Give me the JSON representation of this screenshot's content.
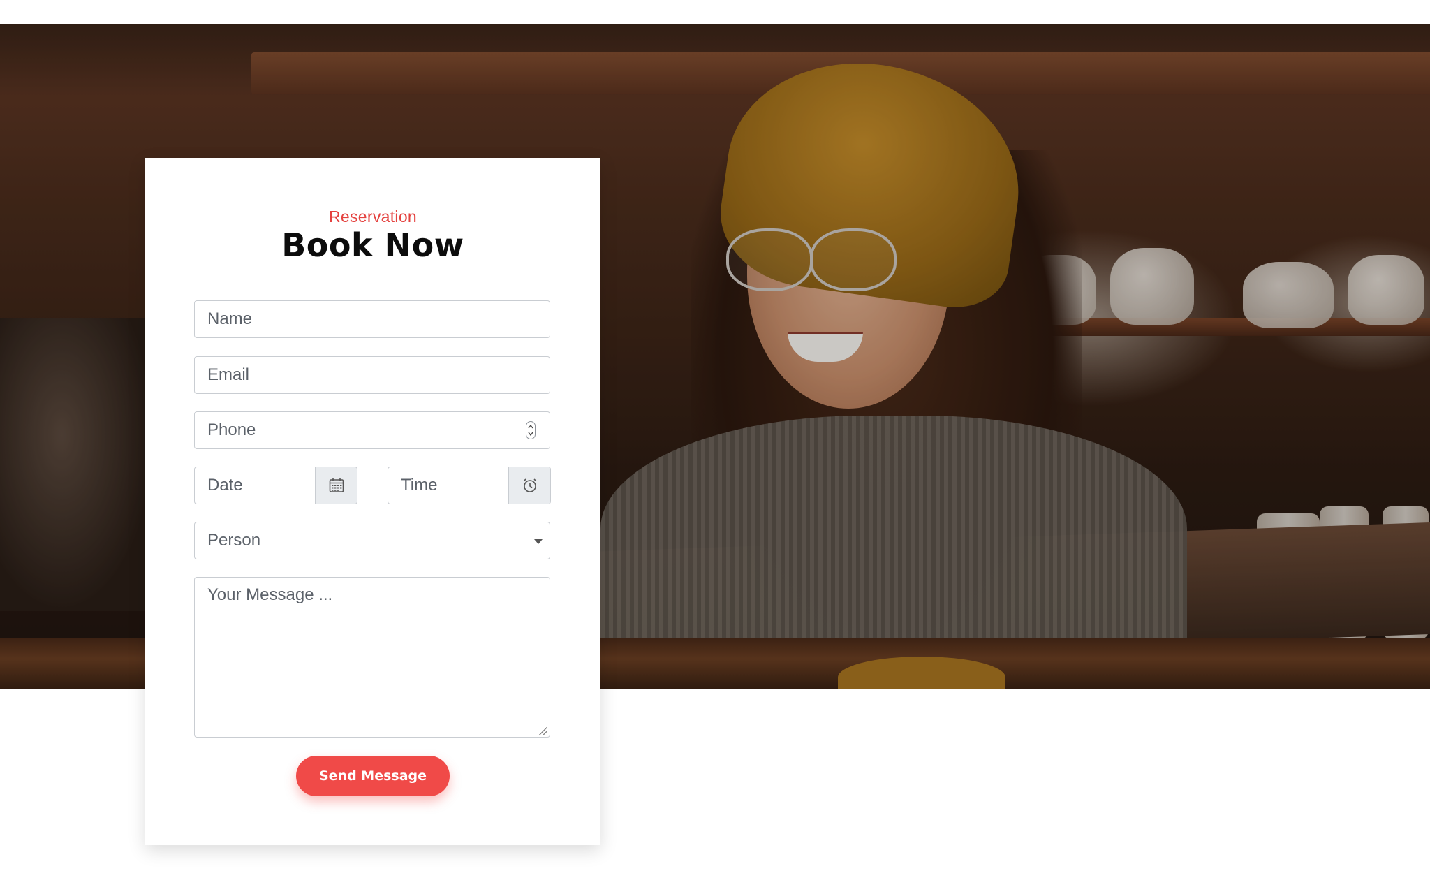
{
  "reservation": {
    "eyebrow": "Reservation",
    "title": "Book Now"
  },
  "form": {
    "name_placeholder": "Name",
    "email_placeholder": "Email",
    "phone_placeholder": "Phone",
    "date_placeholder": "Date",
    "time_placeholder": "Time",
    "person_placeholder": "Person",
    "message_placeholder": "Your Message ...",
    "submit_label": "Send Message"
  },
  "icons": {
    "date_addon": "calendar-icon",
    "time_addon": "alarm-clock-icon",
    "phone_spinner": "number-spinner-icon",
    "person_dropdown": "chevron-down-icon"
  },
  "colors": {
    "accent": "#f04a48",
    "eyebrow": "#e4423f",
    "heading": "#0c0c0c",
    "placeholder": "#5b6169",
    "input_border": "#c9cdd2",
    "addon_bg": "#e9ecef"
  }
}
